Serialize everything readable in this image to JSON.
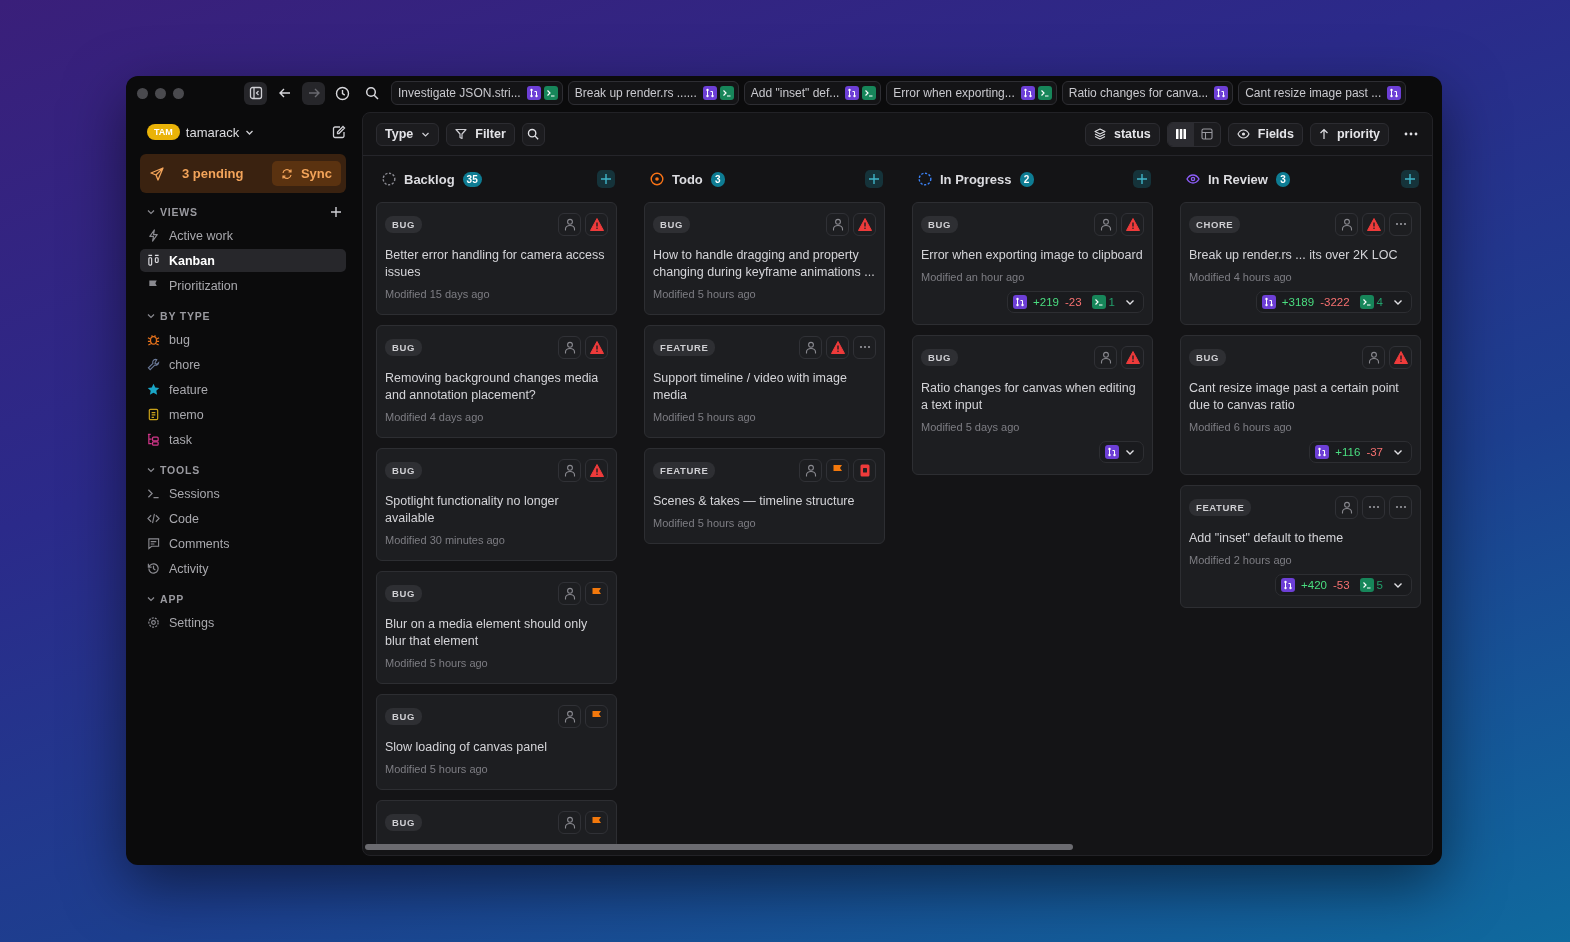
{
  "tabs": [
    {
      "title": "Investigate JSON.stri...",
      "badges": [
        {
          "kind": "pr"
        },
        {
          "kind": "session"
        }
      ]
    },
    {
      "title": "Break up render.rs ......",
      "badges": [
        {
          "kind": "pr"
        },
        {
          "kind": "session"
        }
      ]
    },
    {
      "title": "Add \"inset\" def...",
      "badges": [
        {
          "kind": "pr"
        },
        {
          "kind": "session"
        }
      ]
    },
    {
      "title": "Error when exporting...",
      "badges": [
        {
          "kind": "pr"
        },
        {
          "kind": "session"
        }
      ]
    },
    {
      "title": "Ratio changes for canva...",
      "badges": [
        {
          "kind": "pr"
        }
      ]
    },
    {
      "title": "Cant resize image past ...",
      "badges": [
        {
          "kind": "pr"
        }
      ]
    }
  ],
  "workspace": {
    "badge": "TAM",
    "name": "tamarack"
  },
  "sync": {
    "pending": "3 pending",
    "button": "Sync"
  },
  "sidebar": [
    {
      "title": "VIEWS",
      "items": [
        {
          "label": "Active work",
          "selected": false
        },
        {
          "label": "Kanban",
          "selected": true
        },
        {
          "label": "Prioritization",
          "selected": false
        }
      ]
    },
    {
      "title": "BY TYPE",
      "items": [
        {
          "label": "bug",
          "selected": false
        },
        {
          "label": "chore",
          "selected": false
        },
        {
          "label": "feature",
          "selected": false
        },
        {
          "label": "memo",
          "selected": false
        },
        {
          "label": "task",
          "selected": false
        }
      ]
    },
    {
      "title": "TOOLS",
      "items": [
        {
          "label": "Sessions",
          "selected": false
        },
        {
          "label": "Code",
          "selected": false
        },
        {
          "label": "Comments",
          "selected": false
        },
        {
          "label": "Activity",
          "selected": false
        }
      ]
    },
    {
      "title": "APP",
      "items": [
        {
          "label": "Settings",
          "selected": false
        }
      ]
    }
  ],
  "toolbar": {
    "type": "Type",
    "filter": "Filter",
    "group": "status",
    "layouts": [
      {
        "selected": true
      },
      {
        "selected": false
      }
    ],
    "fields": "Fields",
    "sort": "priority"
  },
  "columns": [
    {
      "title": "Backlog",
      "count": "35",
      "kind": "backlog",
      "cards": [
        {
          "type": "BUG",
          "title": "Better error handling for camera access issues",
          "modified": "Modified 15 days ago",
          "icons": [
            {
              "kind": "assignee"
            },
            {
              "kind": "urgent"
            }
          ]
        },
        {
          "type": "BUG",
          "title": "Removing background changes media and annotation placement?",
          "modified": "Modified 4 days ago",
          "icons": [
            {
              "kind": "assignee"
            },
            {
              "kind": "urgent"
            }
          ]
        },
        {
          "type": "BUG",
          "title": "Spotlight functionality no longer available",
          "modified": "Modified 30 minutes ago",
          "icons": [
            {
              "kind": "assignee"
            },
            {
              "kind": "urgent"
            }
          ]
        },
        {
          "type": "BUG",
          "title": "Blur on a media element should only blur that element",
          "modified": "Modified 5 hours ago",
          "icons": [
            {
              "kind": "assignee"
            },
            {
              "kind": "high"
            }
          ]
        },
        {
          "type": "BUG",
          "title": "Slow loading of canvas panel",
          "modified": "Modified 5 hours ago",
          "icons": [
            {
              "kind": "assignee"
            },
            {
              "kind": "high"
            }
          ]
        },
        {
          "type": "BUG",
          "icons": [
            {
              "kind": "assignee"
            },
            {
              "kind": "high"
            }
          ]
        }
      ]
    },
    {
      "title": "Todo",
      "count": "3",
      "kind": "todo",
      "cards": [
        {
          "type": "BUG",
          "title": "How to handle dragging and property changing during keyframe animations ...",
          "modified": "Modified 5 hours ago",
          "icons": [
            {
              "kind": "assignee"
            },
            {
              "kind": "urgent"
            }
          ]
        },
        {
          "type": "FEATURE",
          "title": "Support timeline / video with image media",
          "modified": "Modified 5 hours ago",
          "icons": [
            {
              "kind": "assignee"
            },
            {
              "kind": "urgent"
            },
            {
              "kind": "more"
            }
          ]
        },
        {
          "type": "FEATURE",
          "title": "Scenes & takes — timeline structure",
          "modified": "Modified 5 hours ago",
          "icons": [
            {
              "kind": "assignee"
            },
            {
              "kind": "high"
            },
            {
              "kind": "blocked"
            }
          ]
        }
      ]
    },
    {
      "title": "In Progress",
      "count": "2",
      "kind": "in_progress",
      "cards": [
        {
          "type": "BUG",
          "title": "Error when exporting image to clipboard",
          "modified": "Modified an hour ago",
          "icons": [
            {
              "kind": "assignee"
            },
            {
              "kind": "urgent"
            }
          ],
          "footer": {
            "kind": "pr",
            "additions": "+219",
            "deletions": "-23",
            "sessions": "1"
          }
        },
        {
          "type": "BUG",
          "title": "Ratio changes for canvas when editing a text input",
          "modified": "Modified 5 days ago",
          "icons": [
            {
              "kind": "assignee"
            },
            {
              "kind": "urgent"
            }
          ],
          "footer": {
            "kind": "pr"
          }
        }
      ]
    },
    {
      "title": "In Review",
      "count": "3",
      "kind": "in_review",
      "cards": [
        {
          "type": "CHORE",
          "title": "Break up render.rs ... its over 2K LOC",
          "modified": "Modified 4 hours ago",
          "icons": [
            {
              "kind": "assignee"
            },
            {
              "kind": "urgent"
            },
            {
              "kind": "more"
            }
          ],
          "footer": {
            "kind": "pr",
            "additions": "+3189",
            "deletions": "-3222",
            "sessions": "4"
          }
        },
        {
          "type": "BUG",
          "title": "Cant resize image past a certain point due to canvas ratio",
          "modified": "Modified 6 hours ago",
          "icons": [
            {
              "kind": "assignee"
            },
            {
              "kind": "urgent"
            }
          ],
          "footer": {
            "kind": "pr",
            "additions": "+116",
            "deletions": "-37"
          }
        },
        {
          "type": "FEATURE",
          "title": "Add \"inset\" default to theme",
          "modified": "Modified 2 hours ago",
          "icons": [
            {
              "kind": "assignee"
            },
            {
              "kind": "more"
            },
            {
              "kind": "more"
            }
          ],
          "footer": {
            "kind": "pr",
            "additions": "+420",
            "deletions": "-53",
            "sessions": "5"
          }
        }
      ]
    }
  ]
}
